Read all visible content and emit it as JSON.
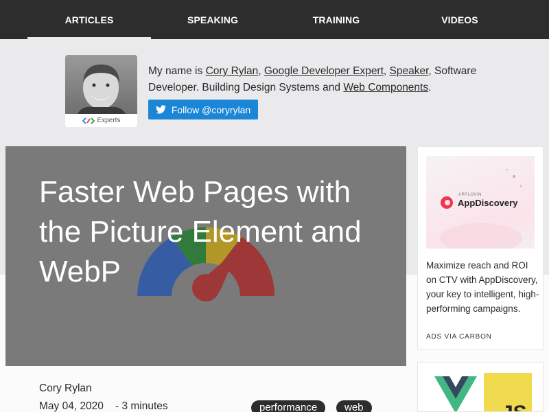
{
  "nav": {
    "items": [
      {
        "label": "ARTICLES",
        "active": true
      },
      {
        "label": "SPEAKING",
        "active": false
      },
      {
        "label": "TRAINING",
        "active": false
      },
      {
        "label": "VIDEOS",
        "active": false
      }
    ]
  },
  "bio": {
    "avatar_caption": "Experts",
    "intro": "My name is ",
    "name_link": "Cory Rylan",
    "sep1": ", ",
    "gde_link": "Google Developer Expert",
    "sep2": ", ",
    "speaker_link": "Speaker",
    "middle": ", Software Developer. Building Design Systems and ",
    "webcomponents_link": "Web Components",
    "end": ".",
    "follow_label": "Follow @coryrylan"
  },
  "article": {
    "title": "Faster Web Pages with the Picture Element and WebP",
    "author": "Cory Rylan",
    "date": "May 04, 2020",
    "read_time": "- 3 minutes",
    "tags": [
      "performance",
      "web"
    ]
  },
  "ad": {
    "brand_small": "APPLOVIN",
    "brand_name": "AppDiscovery",
    "text": "Maximize reach and ROI on CTV with AppDiscovery, your key to intelligent, high-performing campaigns.",
    "via": "ADS VIA CARBON"
  },
  "card2": {
    "js_label": "JS"
  },
  "colors": {
    "nav_bg": "#2d2d2d",
    "bio_bg": "#eaeaec",
    "hero_bg": "#7a7a7a",
    "follow_btn": "#1b86d6",
    "tag_bg": "#2d2d2d"
  }
}
